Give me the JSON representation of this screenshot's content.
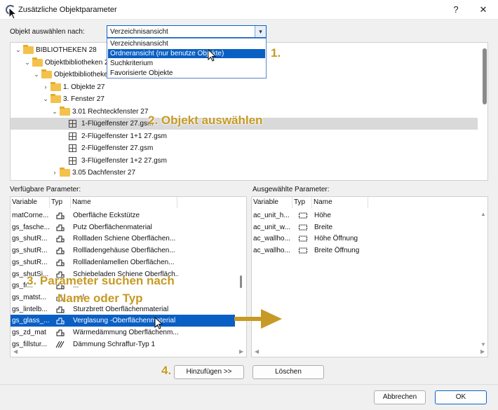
{
  "window": {
    "title": "Zusätzliche Objektparameter",
    "help_label": "?",
    "close_label": "✕"
  },
  "select_by": {
    "label": "Objekt auswählen nach:",
    "value": "Verzeichnisansicht",
    "options": [
      "Verzeichnisansicht",
      "Ordneransicht (nur benutze Objekte)",
      "Suchkriterium",
      "Favorisierte Objekte"
    ],
    "selected_index": 1
  },
  "tree": [
    {
      "label": "BIBLIOTHEKEN 28",
      "indent": 0,
      "type": "folder",
      "chevron": "down"
    },
    {
      "label": "Objektbibliotheken 28",
      "indent": 1,
      "type": "folder",
      "chevron": "down"
    },
    {
      "label": "Objektbibliotheken 28",
      "indent": 2,
      "type": "folder",
      "chevron": "down"
    },
    {
      "label": "1. Objekte 27",
      "indent": 3,
      "type": "folder",
      "chevron": "right"
    },
    {
      "label": "3. Fenster 27",
      "indent": 3,
      "type": "folder",
      "chevron": "down"
    },
    {
      "label": "3.01 Rechteckfenster 27",
      "indent": 4,
      "type": "folder",
      "chevron": "down"
    },
    {
      "label": "1-Flügelfenster 27.gsm",
      "indent": 5,
      "type": "object",
      "selected": true
    },
    {
      "label": "2-Flügelfenster 1+1 27.gsm",
      "indent": 5,
      "type": "object"
    },
    {
      "label": "2-Flügelfenster 27.gsm",
      "indent": 5,
      "type": "object"
    },
    {
      "label": "3-Flügelfenster 1+2 27.gsm",
      "indent": 5,
      "type": "object"
    },
    {
      "label": "3.05 Dachfenster 27",
      "indent": 4,
      "type": "folder",
      "chevron": "right"
    }
  ],
  "available": {
    "label": "Verfügbare Parameter:",
    "columns": [
      "Variable",
      "Typ",
      "Name"
    ],
    "rows": [
      {
        "variable": "matCorne...",
        "name": "Oberfläche Eckstütze",
        "icon": "material-icon"
      },
      {
        "variable": "gs_fasche...",
        "name": "Putz Oberflächenmaterial",
        "icon": "material-icon"
      },
      {
        "variable": "gs_shutR...",
        "name": "Rollladen Schiene Oberflächen...",
        "icon": "material-icon"
      },
      {
        "variable": "gs_shutR...",
        "name": "Rollladengehäuse Oberflächen...",
        "icon": "material-icon"
      },
      {
        "variable": "gs_shutR...",
        "name": "Rollladenlamellen Oberflächen...",
        "icon": "material-icon"
      },
      {
        "variable": "gs_shutSi...",
        "name": "Schiebeladen Schiene Oberfläch...",
        "icon": "material-icon"
      },
      {
        "variable": "gs_fr...",
        "name": "...",
        "icon": "material-icon"
      },
      {
        "variable": "gs_matst...",
        "name": "...al",
        "icon": "material-icon"
      },
      {
        "variable": "gs_lintelb...",
        "name": "Sturzbrett Oberflächenmaterial",
        "icon": "material-icon"
      },
      {
        "variable": "gs_glass_...",
        "name": "Verglasung -Oberflächenmaterial",
        "icon": "material-icon",
        "selected": true
      },
      {
        "variable": "gs_zd_mat",
        "name": "Wärmedämmung Oberflächenm...",
        "icon": "material-icon"
      },
      {
        "variable": "gs_fillstur...",
        "name": "Dämmung Schraffur-Typ 1",
        "icon": "hatch-icon"
      }
    ]
  },
  "selected": {
    "label": "Ausgewählte Parameter:",
    "columns": [
      "Variable",
      "Typ",
      "Name"
    ],
    "rows": [
      {
        "variable": "ac_unit_h...",
        "name": "Höhe"
      },
      {
        "variable": "ac_unit_w...",
        "name": "Breite"
      },
      {
        "variable": "ac_wallho...",
        "name": "Höhe Öffnung"
      },
      {
        "variable": "ac_wallho...",
        "name": "Breite Öffnung"
      }
    ]
  },
  "buttons": {
    "add": "Hinzufügen >>",
    "delete": "Löschen",
    "cancel": "Abbrechen",
    "ok": "OK"
  },
  "annotations": {
    "a1": "1.",
    "a2": "2. Objekt auswählen",
    "a3_line1": "3. Parameter suchen nach",
    "a3_line2": "Name oder Typ",
    "a4": "4."
  },
  "colors": {
    "accent": "#0a5fc4",
    "annotation": "#c69a24",
    "folder": "#f3c24d"
  }
}
